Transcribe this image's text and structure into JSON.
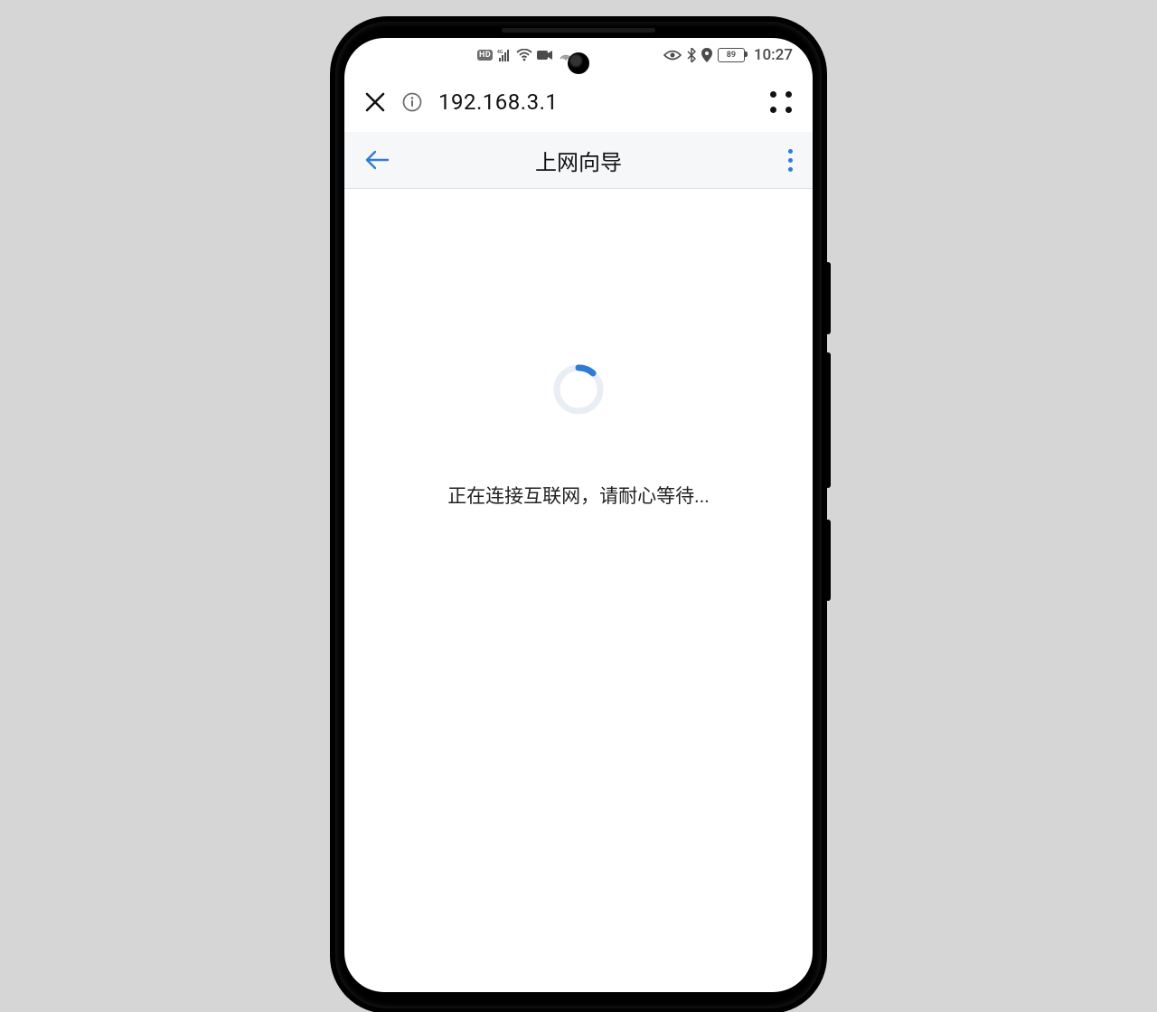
{
  "status_bar": {
    "hd_label": "HD",
    "network_gen": "4G",
    "battery_text": "89",
    "clock": "10:27"
  },
  "browser_bar": {
    "address": "192.168.3.1"
  },
  "page_header": {
    "title": "上网向导"
  },
  "content": {
    "status_text": "正在连接互联网，请耐心等待..."
  },
  "colors": {
    "accent": "#2f7bd6"
  }
}
